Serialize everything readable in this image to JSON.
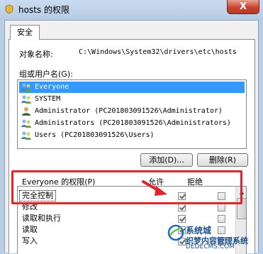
{
  "window": {
    "title": "hosts 的权限",
    "close_label": "X"
  },
  "tabs": [
    {
      "label": "安全"
    }
  ],
  "object": {
    "label": "对象名称:",
    "value": "C:\\Windows\\System32\\drivers\\etc\\hosts"
  },
  "groups": {
    "label": "组或用户名(G):",
    "items": [
      {
        "name": "Everyone",
        "icon": "users-group-icon",
        "selected": true
      },
      {
        "name": "SYSTEM",
        "icon": "users-group-icon",
        "selected": false
      },
      {
        "name": "Administrator  (PC201803091526\\Administrator)",
        "icon": "user-icon",
        "selected": false
      },
      {
        "name": "Administrators (PC201803091526\\Administrators)",
        "icon": "users-group-icon",
        "selected": false
      },
      {
        "name": "Users (PC201803091526\\Users)",
        "icon": "users-group-icon",
        "selected": false
      }
    ]
  },
  "buttons": {
    "add": "添加(D)...",
    "remove": "删除(R)"
  },
  "permissions": {
    "header": "Everyone 的权限(P)",
    "allow_label": "允许",
    "deny_label": "拒绝",
    "rows": [
      {
        "name": "完全控制",
        "allow": true,
        "deny": false
      },
      {
        "name": "修改",
        "allow": true,
        "deny": false
      },
      {
        "name": "读取和执行",
        "allow": true,
        "deny": false
      },
      {
        "name": "读取",
        "allow": true,
        "deny": false
      },
      {
        "name": "写入",
        "allow": true,
        "deny": false
      }
    ]
  },
  "watermark": {
    "line1": "系统城",
    "line2": "织梦内容管理系统",
    "line3": "DEDECMS.COM"
  },
  "colors": {
    "selection": "#3399ff",
    "highlight_box": "#e0262b",
    "titlebar": "#b9cde4"
  }
}
